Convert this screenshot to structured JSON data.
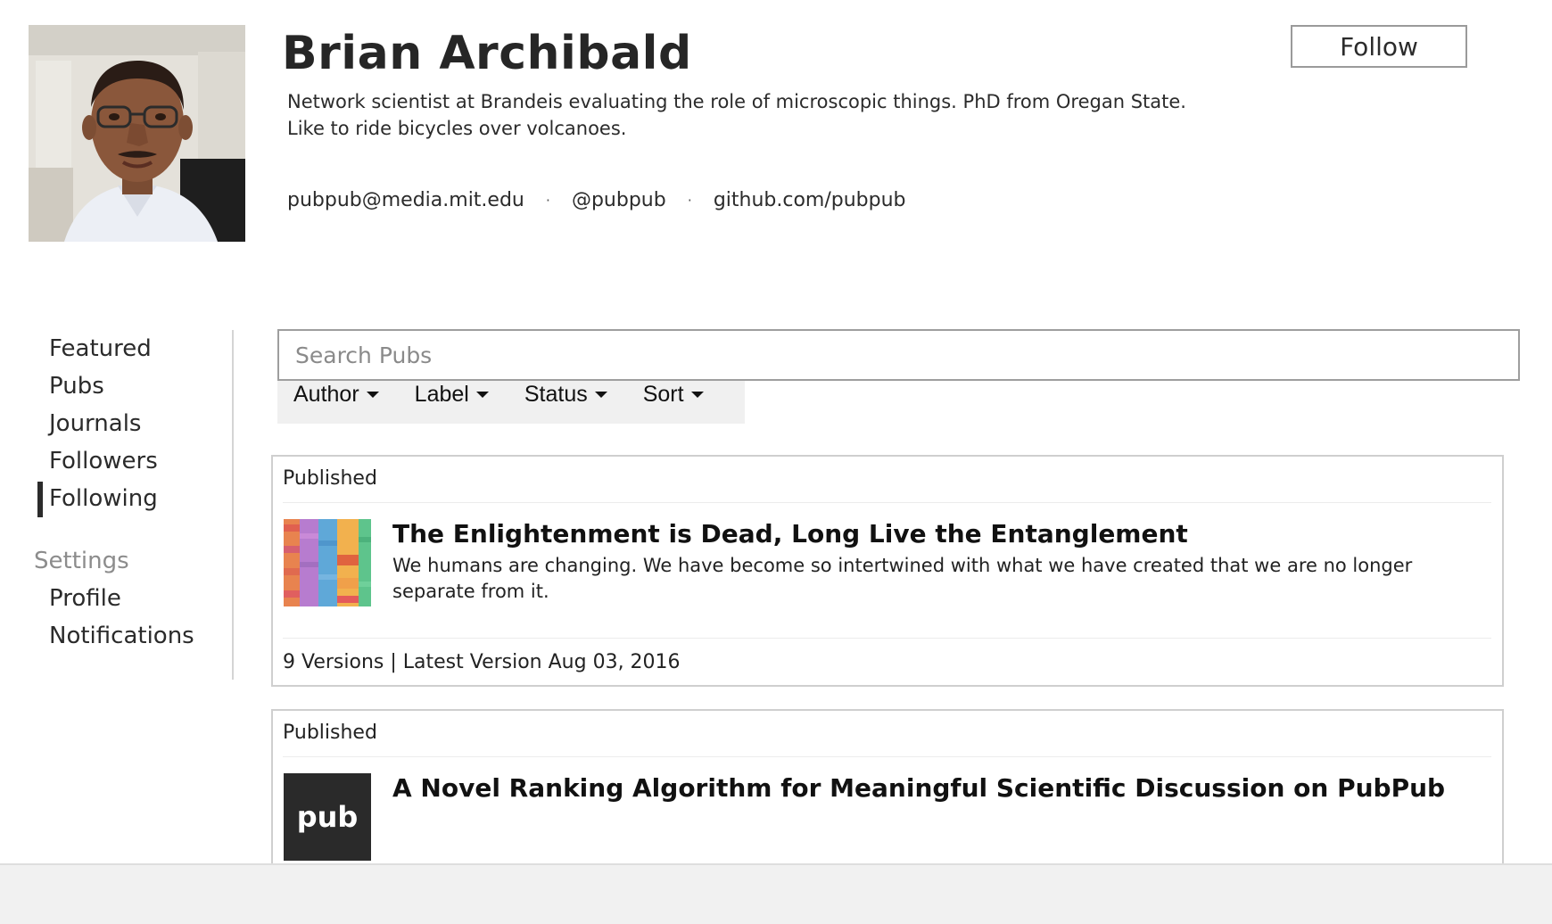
{
  "profile": {
    "name": "Brian Archibald",
    "bio": "Network scientist at Brandeis evaluating the role of microscopic things. PhD from Oregan State. Like to ride bicycles over volcanoes.",
    "email": "pubpub@media.mit.edu",
    "twitter": "@pubpub",
    "github": "github.com/pubpub",
    "separator": "·",
    "follow_label": "Follow"
  },
  "sidebar": {
    "items": [
      {
        "label": "Featured"
      },
      {
        "label": "Pubs"
      },
      {
        "label": "Journals"
      },
      {
        "label": "Followers"
      },
      {
        "label": "Following",
        "active": true
      }
    ],
    "settings_heading": "Settings",
    "settings_items": [
      {
        "label": "Profile"
      },
      {
        "label": "Notifications"
      }
    ]
  },
  "search": {
    "placeholder": "Search Pubs",
    "value": ""
  },
  "filters": [
    {
      "label": "Author"
    },
    {
      "label": "Label"
    },
    {
      "label": "Status"
    },
    {
      "label": "Sort"
    }
  ],
  "pubs": [
    {
      "status": "Published",
      "title": "The Enlightenment is Dead, Long Live the Entanglement",
      "description": "We humans are changing. We have become so intertwined with what we have created that we are no longer separate from it.",
      "meta": "9 Versions | Latest Version Aug 03, 2016",
      "thumb_icon": "colorful-grid-thumbnail"
    },
    {
      "status": "Published",
      "title": "A Novel Ranking Algorithm for Meaningful Scientific Discussion on PubPub",
      "thumb_text": "pub",
      "thumb_icon": "pub-logo-thumbnail"
    }
  ],
  "colors": {
    "text": "#222222",
    "muted": "#8c8c8c",
    "border": "#cfcfcf",
    "filter_bar": "#f0f0f0",
    "pub_tile": "#2a2a2a"
  }
}
